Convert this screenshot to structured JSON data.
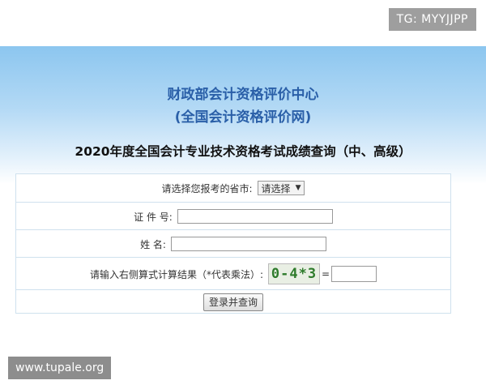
{
  "watermark_top": "TG: MYYJJPP",
  "header": {
    "org_name": "财政部会计资格评价中心",
    "org_site": "(全国会计资格评价网)",
    "page_title": "2020年度全国会计专业技术资格考试成绩查询（中、高级）"
  },
  "form": {
    "province_label": "请选择您报考的省市:",
    "province_selected": "请选择",
    "id_label": "证 件 号:",
    "id_value": "",
    "name_label": "姓 名:",
    "name_value": "",
    "captcha_label": "请输入右侧算式计算结果（*代表乘法）:",
    "captcha_text": "0-4*3",
    "equals": "=",
    "captcha_value": "",
    "submit_label": "登录并查询"
  },
  "watermark_bottom": "www.tupale.org",
  "colors": {
    "org_text": "#2a5fa8",
    "hero_top": "#8cc6ef",
    "border": "#cfe1ee",
    "captcha_text": "#2e7b2b"
  },
  "icons": {
    "select_arrow": "chevron-down-icon"
  }
}
